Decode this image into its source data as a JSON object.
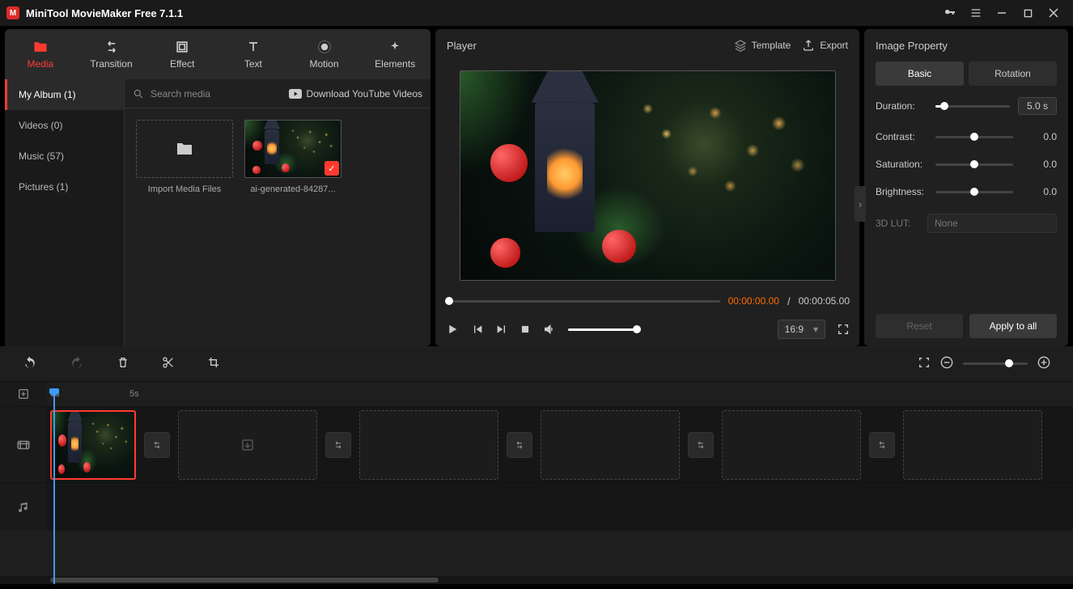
{
  "titlebar": {
    "title": "MiniTool MovieMaker Free 7.1.1"
  },
  "topTabs": {
    "media": "Media",
    "transition": "Transition",
    "effect": "Effect",
    "text": "Text",
    "motion": "Motion",
    "elements": "Elements"
  },
  "albums": {
    "myalbum": "My Album (1)",
    "videos": "Videos (0)",
    "music": "Music (57)",
    "pictures": "Pictures (1)"
  },
  "mediaToolbar": {
    "searchPlaceholder": "Search media",
    "downloadYT": "Download YouTube Videos"
  },
  "mediaItems": {
    "import": "Import Media Files",
    "clip1": "ai-generated-84287..."
  },
  "player": {
    "title": "Player",
    "template": "Template",
    "export": "Export",
    "currentTime": "00:00:00.00",
    "sep": " / ",
    "totalTime": "00:00:05.00",
    "ratio": "16:9"
  },
  "props": {
    "title": "Image Property",
    "tabBasic": "Basic",
    "tabRotation": "Rotation",
    "duration": {
      "label": "Duration:",
      "value": "5.0 s"
    },
    "contrast": {
      "label": "Contrast:",
      "value": "0.0"
    },
    "saturation": {
      "label": "Saturation:",
      "value": "0.0"
    },
    "brightness": {
      "label": "Brightness:",
      "value": "0.0"
    },
    "lut": {
      "label": "3D LUT:",
      "value": "None"
    },
    "reset": "Reset",
    "apply": "Apply to all"
  },
  "timeline": {
    "tick0": "0s",
    "tick5": "5s"
  }
}
